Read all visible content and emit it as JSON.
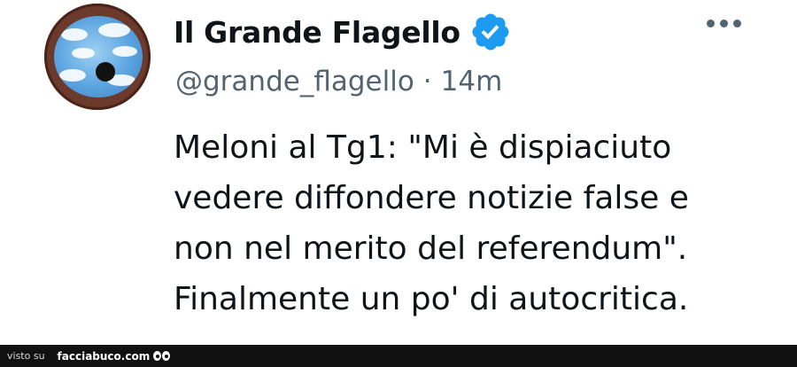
{
  "author": {
    "display_name": "Il Grande Flagello",
    "handle": "@grande_flagello",
    "separator": "·",
    "time": "14m",
    "verified": true
  },
  "tweet": {
    "text": "Meloni al Tg1: \"Mi è dispiaciuto\nvedere diffondere notizie false e\nnon nel merito del referendum\".\nFinalmente un po' di autocritica."
  },
  "footer": {
    "seen_on": "visto su",
    "site": "facciabuco.com"
  },
  "colors": {
    "verified": "#1d9bf0",
    "text": "#0f1419",
    "secondary": "#536471",
    "footer_bg": "#111111"
  }
}
